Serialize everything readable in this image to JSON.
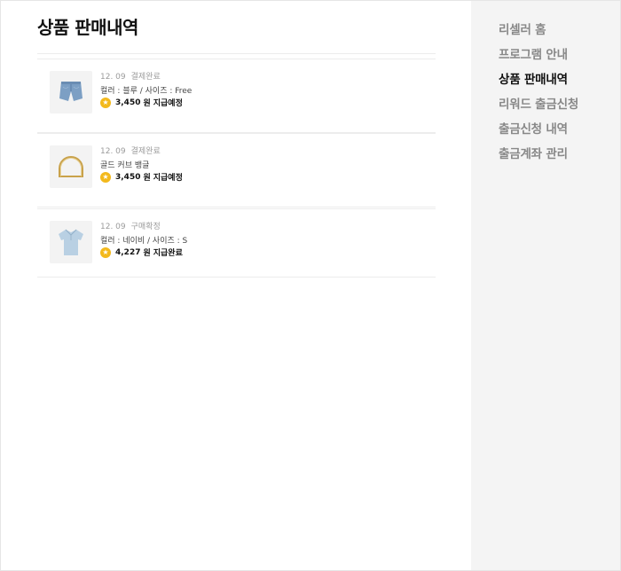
{
  "page": {
    "title": "상품 판매내역"
  },
  "orders": [
    {
      "date": "12. 09",
      "status": "결제완료",
      "options": "컬러 : 블루 / 사이즈 : Free",
      "amount": "3,450",
      "unit": "원",
      "reward_status": "지급예정",
      "thumbnail_icon": "denim-shorts-icon"
    },
    {
      "date": "12. 09",
      "status": "결제완료",
      "options": "골드 커브 뱅글",
      "amount": "3,450",
      "unit": "원",
      "reward_status": "지급예정",
      "thumbnail_icon": "gold-bangle-icon"
    },
    {
      "date": "12. 09",
      "status": "구매확정",
      "options": "컬러 : 네이비 / 사이즈 : S",
      "amount": "4,227",
      "unit": "원",
      "reward_status": "지급완료",
      "thumbnail_icon": "polo-shirt-icon"
    }
  ],
  "sidebar": {
    "items": [
      {
        "label": "리셀러 홈",
        "active": false
      },
      {
        "label": "프로그램 안내",
        "active": false
      },
      {
        "label": "상품 판매내역",
        "active": true
      },
      {
        "label": "리워드 출금신청",
        "active": false
      },
      {
        "label": "출금신청 내역",
        "active": false
      },
      {
        "label": "출금계좌 관리",
        "active": false
      }
    ]
  },
  "colors": {
    "accent_coin": "#f3b91c",
    "sidebar_bg": "#f4f4f4",
    "active_text": "#111111",
    "inactive_text": "#888888"
  }
}
